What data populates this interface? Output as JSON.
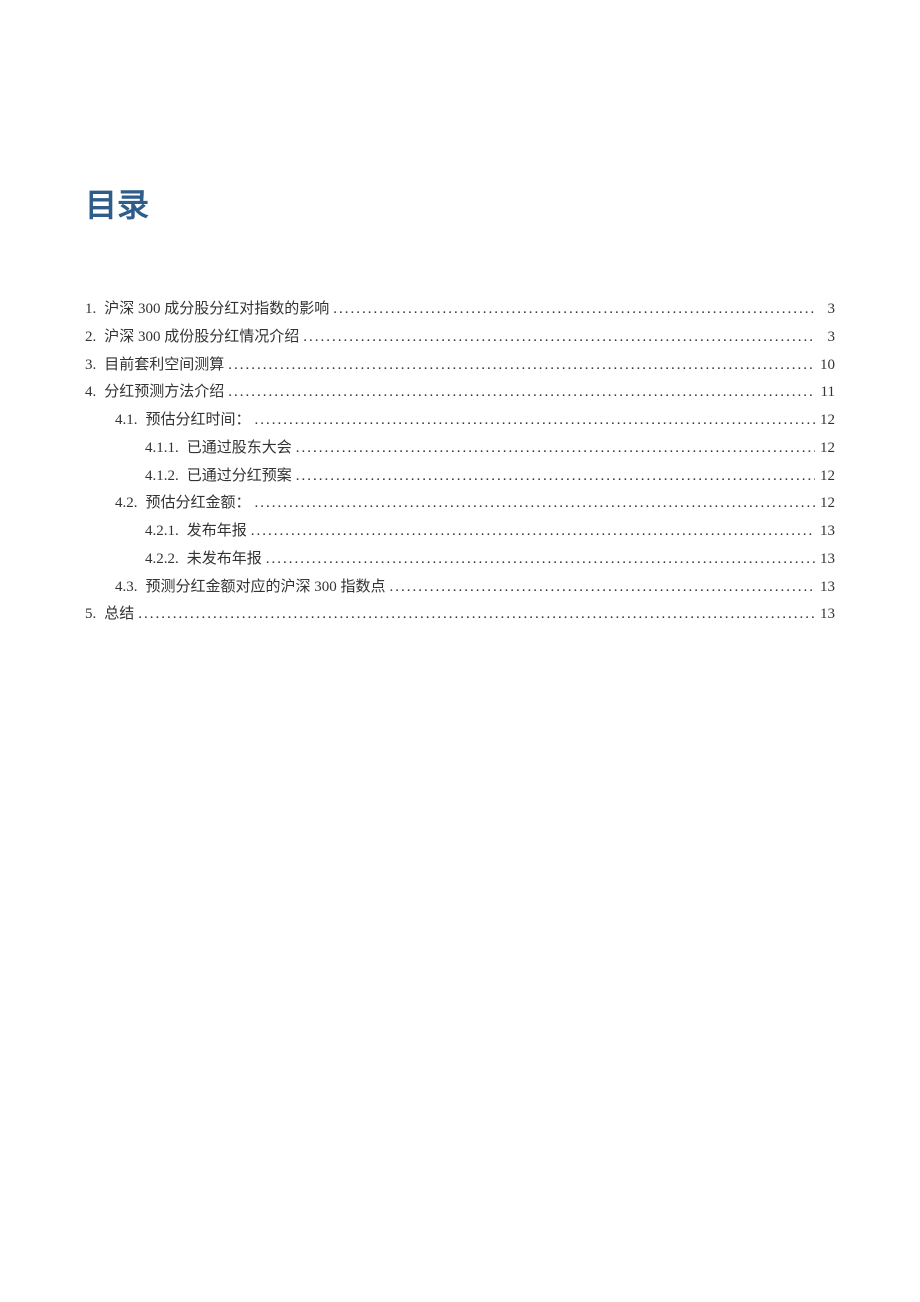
{
  "title": "目录",
  "toc": [
    {
      "level": 1,
      "num": "1.",
      "text": "沪深 300 成分股分红对指数的影响",
      "page": "3"
    },
    {
      "level": 1,
      "num": "2.",
      "text": "沪深 300 成份股分红情况介绍",
      "page": "3"
    },
    {
      "level": 1,
      "num": "3.",
      "text": "目前套利空间测算",
      "page": "10"
    },
    {
      "level": 1,
      "num": "4.",
      "text": "分红预测方法介绍",
      "page": "11"
    },
    {
      "level": 2,
      "num": "4.1.",
      "text": "预估分红时间：",
      "page": "12"
    },
    {
      "level": 3,
      "num": "4.1.1.",
      "text": "已通过股东大会",
      "page": "12"
    },
    {
      "level": 3,
      "num": "4.1.2.",
      "text": "已通过分红预案",
      "page": "12"
    },
    {
      "level": 2,
      "num": "4.2.",
      "text": "预估分红金额：",
      "page": "12"
    },
    {
      "level": 3,
      "num": "4.2.1.",
      "text": "发布年报",
      "page": "13"
    },
    {
      "level": 3,
      "num": "4.2.2.",
      "text": "未发布年报",
      "page": "13"
    },
    {
      "level": 2,
      "num": "4.3.",
      "text": "预测分红金额对应的沪深 300 指数点",
      "page": "13"
    },
    {
      "level": 1,
      "num": "5.",
      "text": "总结",
      "page": "13"
    }
  ]
}
